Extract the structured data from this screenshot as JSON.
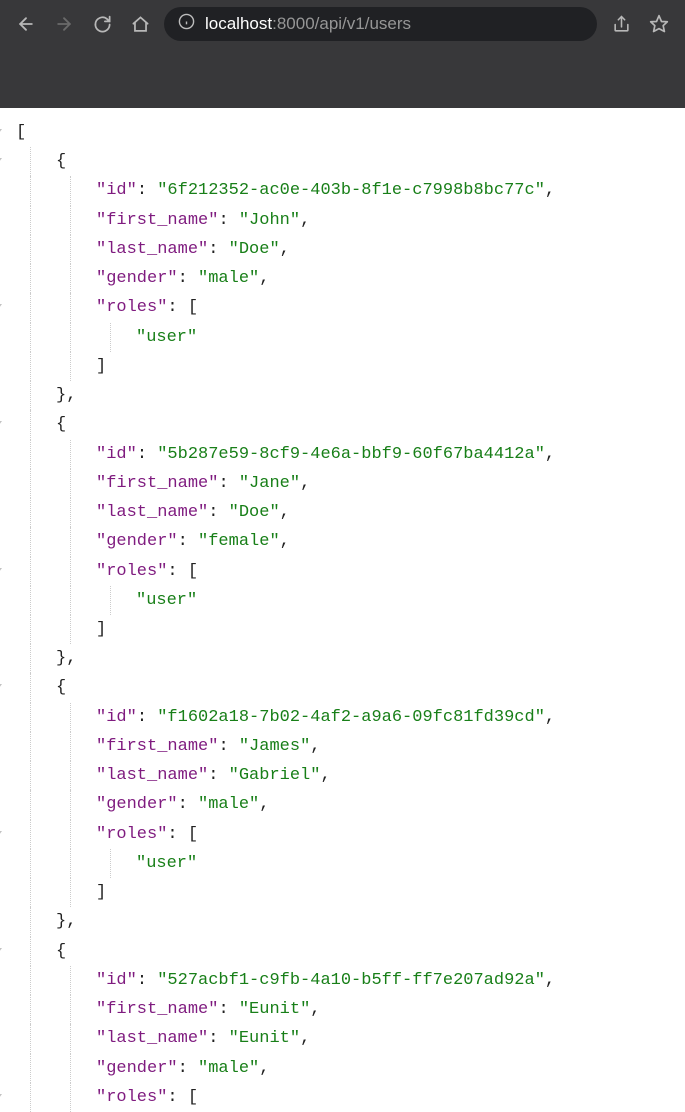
{
  "url": {
    "host": "localhost",
    "rest": ":8000/api/v1/users"
  },
  "json": {
    "open_bracket": "[",
    "close_bracket": "]",
    "open_brace": "{",
    "close_brace_comma": "},",
    "open_sq": "[",
    "close_sq": "]",
    "q": "\"",
    "users": [
      {
        "id_key": "id",
        "id_val": "6f212352-ac0e-403b-8f1e-c7998b8bc77c",
        "first_name_key": "first_name",
        "first_name_val": "John",
        "last_name_key": "last_name",
        "last_name_val": "Doe",
        "gender_key": "gender",
        "gender_val": "male",
        "roles_key": "roles",
        "roles_vals": [
          "user"
        ]
      },
      {
        "id_key": "id",
        "id_val": "5b287e59-8cf9-4e6a-bbf9-60f67ba4412a",
        "first_name_key": "first_name",
        "first_name_val": "Jane",
        "last_name_key": "last_name",
        "last_name_val": "Doe",
        "gender_key": "gender",
        "gender_val": "female",
        "roles_key": "roles",
        "roles_vals": [
          "user"
        ]
      },
      {
        "id_key": "id",
        "id_val": "f1602a18-7b02-4af2-a9a6-09fc81fd39cd",
        "first_name_key": "first_name",
        "first_name_val": "James",
        "last_name_key": "last_name",
        "last_name_val": "Gabriel",
        "gender_key": "gender",
        "gender_val": "male",
        "roles_key": "roles",
        "roles_vals": [
          "user"
        ]
      },
      {
        "id_key": "id",
        "id_val": "527acbf1-c9fb-4a10-b5ff-ff7e207ad92a",
        "first_name_key": "first_name",
        "first_name_val": "Eunit",
        "last_name_key": "last_name",
        "last_name_val": "Eunit",
        "gender_key": "gender",
        "gender_val": "male",
        "roles_key": "roles",
        "roles_vals": []
      }
    ]
  }
}
